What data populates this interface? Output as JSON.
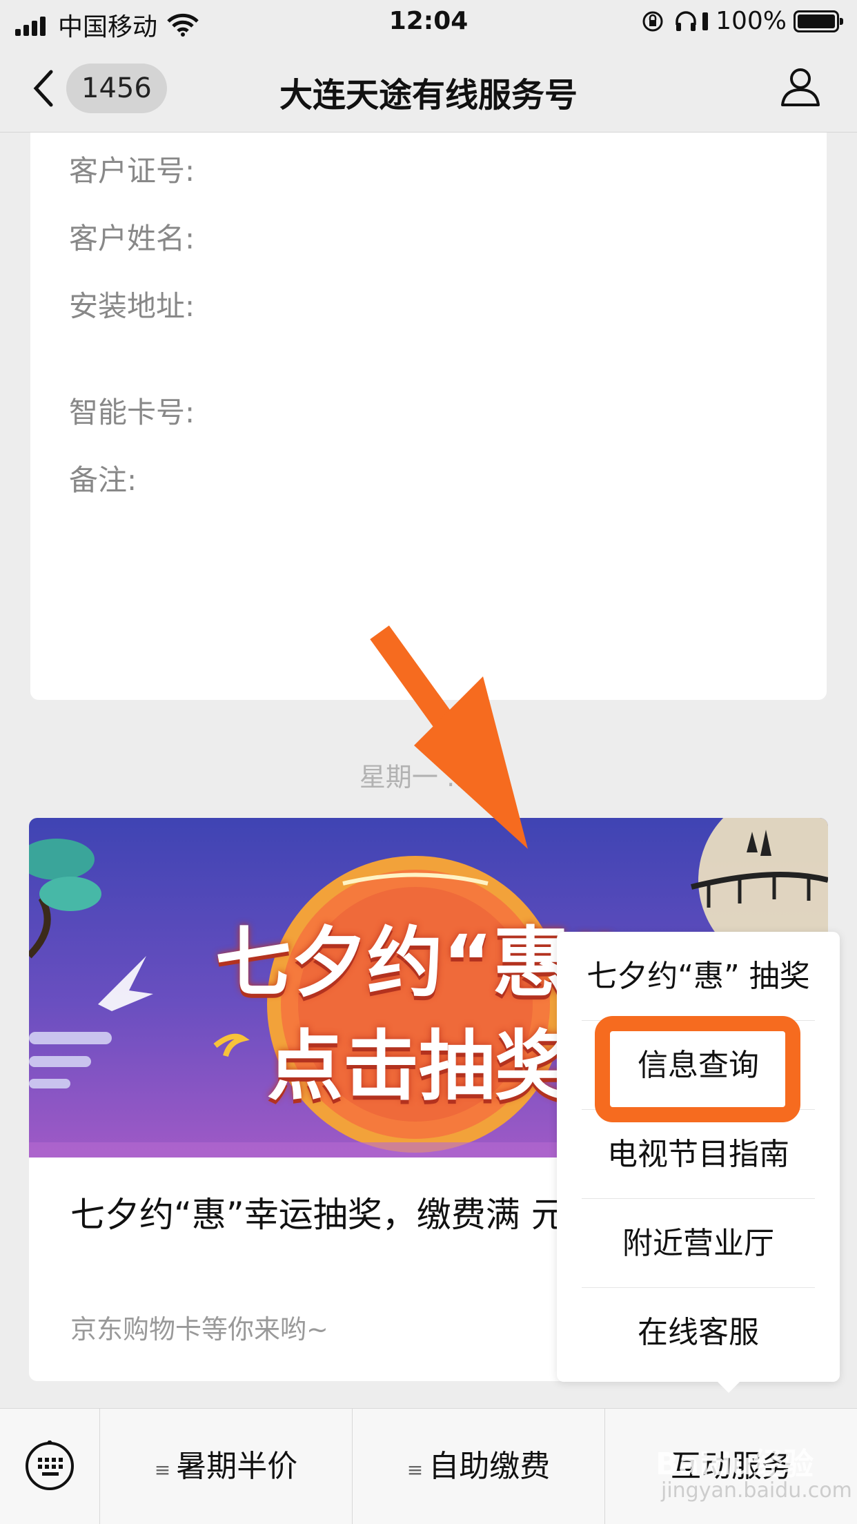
{
  "status_bar": {
    "carrier": "中国移动",
    "time": "12:04",
    "battery": "100%"
  },
  "nav": {
    "unread_count": "1456",
    "title": "大连天途有线服务号"
  },
  "info_card": {
    "fields": [
      "客户证号:",
      "客户姓名:",
      "安装地址:",
      "智能卡号:",
      "备注:"
    ]
  },
  "timestamp": "星期一 … 0",
  "article": {
    "banner_line1": "七夕约“惠”",
    "banner_line2": "点击抽奖",
    "title": "七夕约“惠”幸运抽奖，缴费满 元京东购物卡！",
    "desc": "京东购物卡等你来哟~"
  },
  "popup_menu": {
    "items": [
      "七夕约“惠” 抽奖",
      "信息查询",
      "电视节目指南",
      "附近营业厅",
      "在线客服"
    ],
    "highlight_color": "#f66b1f"
  },
  "bottom_menu": {
    "items": [
      "暑期半价",
      "自助缴费",
      "互动服务"
    ]
  },
  "watermark": {
    "text": "Baidu经验",
    "sub": "jingyan.baidu.com"
  },
  "colors": {
    "background": "#ededed",
    "annotation_orange": "#f66b1f"
  }
}
